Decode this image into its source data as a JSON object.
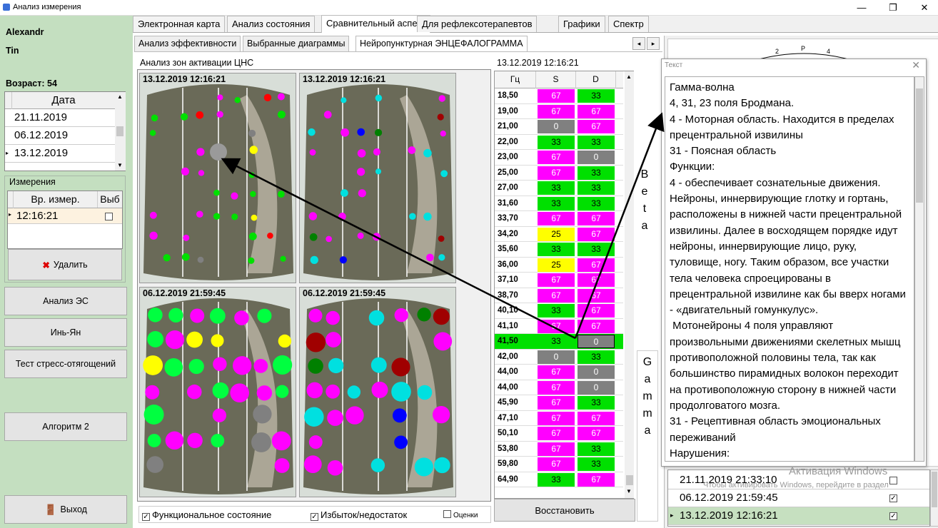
{
  "window": {
    "title": "Анализ измерения",
    "buttons": [
      "—",
      "❐",
      "✕"
    ]
  },
  "user": {
    "first_name": "Alexandr",
    "last_name": "Tin",
    "age_label": "Возраст: 54"
  },
  "dates": {
    "header": "Дата",
    "rows": [
      "21.11.2019",
      "06.12.2019",
      "13.12.2019"
    ],
    "selected_index": 2
  },
  "measurements": {
    "title": "Измерения",
    "col1": "Вр. измер.",
    "col2": "Выб",
    "rows": [
      {
        "time": "12:16:21",
        "checked": false
      }
    ]
  },
  "left_buttons": {
    "delete": "Удалить",
    "analysis": "Анализ ЭС",
    "yinyang": "Инь-Ян",
    "stress": "Тест стресс-отягощений",
    "algo": "Алгоритм 2",
    "exit": "Выход"
  },
  "main_tabs": [
    {
      "label": "Электронная карта",
      "selected": false
    },
    {
      "label": "Анализ состояния",
      "selected": false
    },
    {
      "label": "Сравнительный аспект",
      "selected": true
    },
    {
      "label": "Для рефлексотерапевтов",
      "selected": false
    },
    {
      "label": "Графики",
      "selected": false
    },
    {
      "label": "Спектр",
      "selected": false
    }
  ],
  "sub_tabs": [
    {
      "label": "Анализ эффективности",
      "selected": false
    },
    {
      "label": "Выбранные диаграммы",
      "selected": false
    },
    {
      "label": "Нейропунктурная ЭНЦЕФАЛОГРАММА",
      "selected": true
    }
  ],
  "cns": {
    "title": "Анализ зон активации ЦНС",
    "images": [
      {
        "caption": "13.12.2019 12:16:21"
      },
      {
        "caption": "13.12.2019 12:16:21"
      },
      {
        "caption": "06.12.2019 21:59:45"
      },
      {
        "caption": "06.12.2019 21:59:45"
      }
    ]
  },
  "checkboxes": {
    "functional": "Функциональное состояние",
    "excess": "Избыток/недостаток",
    "scores": "Оценки"
  },
  "freq_table": {
    "timestamp": "13.12.2019 12:16:21",
    "headers": [
      "Гц",
      "S",
      "D"
    ],
    "rows": [
      {
        "hz": "18,50",
        "s": "67",
        "d": "33"
      },
      {
        "hz": "19,00",
        "s": "67",
        "d": "67"
      },
      {
        "hz": "21,00",
        "s": "0",
        "d": "67"
      },
      {
        "hz": "22,00",
        "s": "33",
        "d": "33"
      },
      {
        "hz": "23,00",
        "s": "67",
        "d": "0"
      },
      {
        "hz": "25,00",
        "s": "67",
        "d": "33"
      },
      {
        "hz": "27,00",
        "s": "33",
        "d": "33"
      },
      {
        "hz": "31,60",
        "s": "33",
        "d": "33"
      },
      {
        "hz": "33,70",
        "s": "67",
        "d": "67"
      },
      {
        "hz": "34,20",
        "s": "25",
        "d": "67"
      },
      {
        "hz": "35,60",
        "s": "33",
        "d": "33"
      },
      {
        "hz": "36,00",
        "s": "25",
        "d": "67"
      },
      {
        "hz": "37,10",
        "s": "67",
        "d": "67"
      },
      {
        "hz": "38,70",
        "s": "67",
        "d": "67"
      },
      {
        "hz": "40,10",
        "s": "33",
        "d": "67"
      },
      {
        "hz": "41,10",
        "s": "67",
        "d": "67"
      },
      {
        "hz": "41,50",
        "s": "33",
        "d": "0"
      },
      {
        "hz": "42,00",
        "s": "0",
        "d": "33"
      },
      {
        "hz": "44,00",
        "s": "67",
        "d": "0"
      },
      {
        "hz": "44,00",
        "s": "67",
        "d": "0"
      },
      {
        "hz": "45,90",
        "s": "67",
        "d": "33"
      },
      {
        "hz": "47,10",
        "s": "67",
        "d": "67"
      },
      {
        "hz": "50,10",
        "s": "67",
        "d": "67"
      },
      {
        "hz": "53,80",
        "s": "67",
        "d": "33"
      },
      {
        "hz": "59,80",
        "s": "67",
        "d": "33"
      },
      {
        "hz": "64,90",
        "s": "33",
        "d": "67"
      }
    ],
    "selected_index": 16,
    "restore_button": "Восстановить"
  },
  "band_labels": {
    "beta": [
      "B",
      "e",
      "t",
      "a"
    ],
    "gamma": [
      "G",
      "a",
      "m",
      "m",
      "a"
    ]
  },
  "colors": {
    "67": "#ff00ff",
    "33": "#00e000",
    "25": "#ffff00",
    "0": "#808080",
    "left_panel": "#c4dfc0"
  },
  "popup": {
    "title": "Текст",
    "text": "Гамма-волна\n4, 31, 23 поля Бродмана.\n4 - Моторная область. Находится в пределах прецентральной извилины\n31 - Поясная область\nФункции:\n4 - обеспечивает сознательные движения. Нейроны, иннервирующие глотку и гортань, расположены в нижней части прецентральной извилины. Далее в восходящем порядке идут нейроны, иннервирующие лицо, руку, туловище, ногу. Таким образом, все участки тела человека спроецированы в прецентральной извилине как бы вверх ногами - «двигательный гомункулус».\n Мотонейроны 4 поля управляют произвольными движениями скелетных мышц противоположной половины тела, так как большинство пирамидных волокон переходит на противоположную сторону в нижней части продолговатого мозга.\n31 - Рецептивная область эмоциональных переживаний\nНарушения:"
  },
  "right_list": {
    "rows": [
      {
        "label": "21.11.2019 21:33:10",
        "checked": false
      },
      {
        "label": "06.12.2019 21:59:45",
        "checked": true
      },
      {
        "label": "13.12.2019 12:16:21",
        "checked": true
      }
    ],
    "head_labels": [
      "2",
      "P",
      "4"
    ],
    "watermark": "Активация Windows",
    "watermark2": "Чтобы активировать Windows, перейдите в раздел"
  }
}
